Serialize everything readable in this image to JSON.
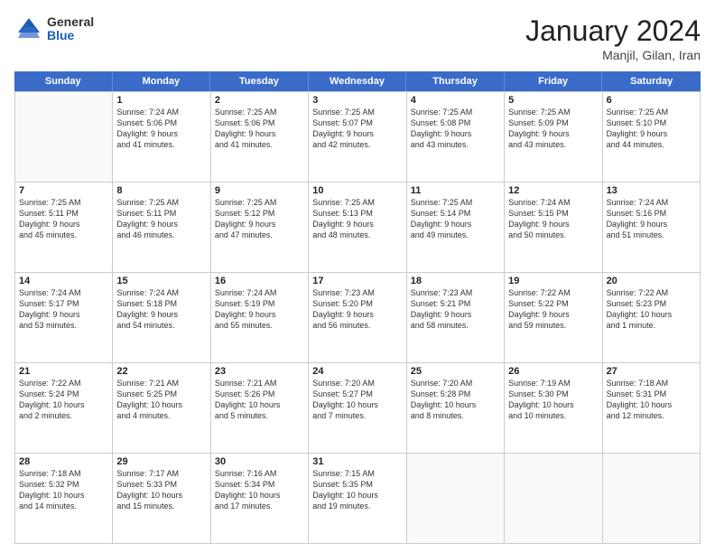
{
  "logo": {
    "general": "General",
    "blue": "Blue"
  },
  "header": {
    "title": "January 2024",
    "location": "Manjil, Gilan, Iran"
  },
  "weekdays": [
    "Sunday",
    "Monday",
    "Tuesday",
    "Wednesday",
    "Thursday",
    "Friday",
    "Saturday"
  ],
  "weeks": [
    [
      {
        "day": null,
        "lines": []
      },
      {
        "day": "1",
        "lines": [
          "Sunrise: 7:24 AM",
          "Sunset: 5:06 PM",
          "Daylight: 9 hours",
          "and 41 minutes."
        ]
      },
      {
        "day": "2",
        "lines": [
          "Sunrise: 7:25 AM",
          "Sunset: 5:06 PM",
          "Daylight: 9 hours",
          "and 41 minutes."
        ]
      },
      {
        "day": "3",
        "lines": [
          "Sunrise: 7:25 AM",
          "Sunset: 5:07 PM",
          "Daylight: 9 hours",
          "and 42 minutes."
        ]
      },
      {
        "day": "4",
        "lines": [
          "Sunrise: 7:25 AM",
          "Sunset: 5:08 PM",
          "Daylight: 9 hours",
          "and 43 minutes."
        ]
      },
      {
        "day": "5",
        "lines": [
          "Sunrise: 7:25 AM",
          "Sunset: 5:09 PM",
          "Daylight: 9 hours",
          "and 43 minutes."
        ]
      },
      {
        "day": "6",
        "lines": [
          "Sunrise: 7:25 AM",
          "Sunset: 5:10 PM",
          "Daylight: 9 hours",
          "and 44 minutes."
        ]
      }
    ],
    [
      {
        "day": "7",
        "lines": [
          "Sunrise: 7:25 AM",
          "Sunset: 5:11 PM",
          "Daylight: 9 hours",
          "and 45 minutes."
        ]
      },
      {
        "day": "8",
        "lines": [
          "Sunrise: 7:25 AM",
          "Sunset: 5:11 PM",
          "Daylight: 9 hours",
          "and 46 minutes."
        ]
      },
      {
        "day": "9",
        "lines": [
          "Sunrise: 7:25 AM",
          "Sunset: 5:12 PM",
          "Daylight: 9 hours",
          "and 47 minutes."
        ]
      },
      {
        "day": "10",
        "lines": [
          "Sunrise: 7:25 AM",
          "Sunset: 5:13 PM",
          "Daylight: 9 hours",
          "and 48 minutes."
        ]
      },
      {
        "day": "11",
        "lines": [
          "Sunrise: 7:25 AM",
          "Sunset: 5:14 PM",
          "Daylight: 9 hours",
          "and 49 minutes."
        ]
      },
      {
        "day": "12",
        "lines": [
          "Sunrise: 7:24 AM",
          "Sunset: 5:15 PM",
          "Daylight: 9 hours",
          "and 50 minutes."
        ]
      },
      {
        "day": "13",
        "lines": [
          "Sunrise: 7:24 AM",
          "Sunset: 5:16 PM",
          "Daylight: 9 hours",
          "and 51 minutes."
        ]
      }
    ],
    [
      {
        "day": "14",
        "lines": [
          "Sunrise: 7:24 AM",
          "Sunset: 5:17 PM",
          "Daylight: 9 hours",
          "and 53 minutes."
        ]
      },
      {
        "day": "15",
        "lines": [
          "Sunrise: 7:24 AM",
          "Sunset: 5:18 PM",
          "Daylight: 9 hours",
          "and 54 minutes."
        ]
      },
      {
        "day": "16",
        "lines": [
          "Sunrise: 7:24 AM",
          "Sunset: 5:19 PM",
          "Daylight: 9 hours",
          "and 55 minutes."
        ]
      },
      {
        "day": "17",
        "lines": [
          "Sunrise: 7:23 AM",
          "Sunset: 5:20 PM",
          "Daylight: 9 hours",
          "and 56 minutes."
        ]
      },
      {
        "day": "18",
        "lines": [
          "Sunrise: 7:23 AM",
          "Sunset: 5:21 PM",
          "Daylight: 9 hours",
          "and 58 minutes."
        ]
      },
      {
        "day": "19",
        "lines": [
          "Sunrise: 7:22 AM",
          "Sunset: 5:22 PM",
          "Daylight: 9 hours",
          "and 59 minutes."
        ]
      },
      {
        "day": "20",
        "lines": [
          "Sunrise: 7:22 AM",
          "Sunset: 5:23 PM",
          "Daylight: 10 hours",
          "and 1 minute."
        ]
      }
    ],
    [
      {
        "day": "21",
        "lines": [
          "Sunrise: 7:22 AM",
          "Sunset: 5:24 PM",
          "Daylight: 10 hours",
          "and 2 minutes."
        ]
      },
      {
        "day": "22",
        "lines": [
          "Sunrise: 7:21 AM",
          "Sunset: 5:25 PM",
          "Daylight: 10 hours",
          "and 4 minutes."
        ]
      },
      {
        "day": "23",
        "lines": [
          "Sunrise: 7:21 AM",
          "Sunset: 5:26 PM",
          "Daylight: 10 hours",
          "and 5 minutes."
        ]
      },
      {
        "day": "24",
        "lines": [
          "Sunrise: 7:20 AM",
          "Sunset: 5:27 PM",
          "Daylight: 10 hours",
          "and 7 minutes."
        ]
      },
      {
        "day": "25",
        "lines": [
          "Sunrise: 7:20 AM",
          "Sunset: 5:28 PM",
          "Daylight: 10 hours",
          "and 8 minutes."
        ]
      },
      {
        "day": "26",
        "lines": [
          "Sunrise: 7:19 AM",
          "Sunset: 5:30 PM",
          "Daylight: 10 hours",
          "and 10 minutes."
        ]
      },
      {
        "day": "27",
        "lines": [
          "Sunrise: 7:18 AM",
          "Sunset: 5:31 PM",
          "Daylight: 10 hours",
          "and 12 minutes."
        ]
      }
    ],
    [
      {
        "day": "28",
        "lines": [
          "Sunrise: 7:18 AM",
          "Sunset: 5:32 PM",
          "Daylight: 10 hours",
          "and 14 minutes."
        ]
      },
      {
        "day": "29",
        "lines": [
          "Sunrise: 7:17 AM",
          "Sunset: 5:33 PM",
          "Daylight: 10 hours",
          "and 15 minutes."
        ]
      },
      {
        "day": "30",
        "lines": [
          "Sunrise: 7:16 AM",
          "Sunset: 5:34 PM",
          "Daylight: 10 hours",
          "and 17 minutes."
        ]
      },
      {
        "day": "31",
        "lines": [
          "Sunrise: 7:15 AM",
          "Sunset: 5:35 PM",
          "Daylight: 10 hours",
          "and 19 minutes."
        ]
      },
      {
        "day": null,
        "lines": []
      },
      {
        "day": null,
        "lines": []
      },
      {
        "day": null,
        "lines": []
      }
    ]
  ]
}
